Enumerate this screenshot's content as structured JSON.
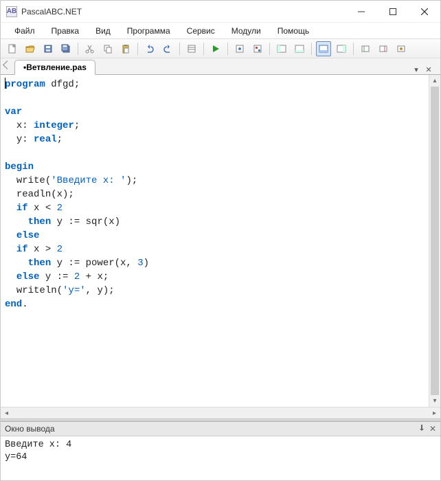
{
  "app": {
    "title": "PascalABC.NET",
    "icon_label": "AB"
  },
  "menu": {
    "file": "Файл",
    "edit": "Правка",
    "view": "Вид",
    "program": "Программа",
    "service": "Сервис",
    "modules": "Модули",
    "help": "Помощь"
  },
  "tab": {
    "label": "•Ветвление.pas"
  },
  "code": {
    "l1_kw": "program",
    "l1_name": " dfgd;",
    "l3_kw": "var",
    "l4_indent": "  ",
    "l4_id": "x: ",
    "l4_type": "integer",
    "l4_semi": ";",
    "l5_indent": "  ",
    "l5_id": "y: ",
    "l5_type": "real",
    "l5_semi": ";",
    "l7_kw": "begin",
    "l8_indent": "  ",
    "l8_fn": "write(",
    "l8_str": "'Введите x: '",
    "l8_end": ");",
    "l9_indent": "  ",
    "l9_txt": "readln(x);",
    "l10_indent": "  ",
    "l10_kw": "if",
    "l10_a": " x < ",
    "l10_num": "2",
    "l11_indent": "    ",
    "l11_kw": "then",
    "l11_a": " y := sqr(x)",
    "l12_indent": "  ",
    "l12_kw": "else",
    "l13_indent": "  ",
    "l13_kw": "if",
    "l13_a": " x > ",
    "l13_num": "2",
    "l14_indent": "    ",
    "l14_kw": "then",
    "l14_a": " y := power(x, ",
    "l14_num": "3",
    "l14_end": ")",
    "l15_indent": "  ",
    "l15_kw": "else",
    "l15_a": " y := ",
    "l15_num": "2",
    "l15_b": " + x;",
    "l16_indent": "  ",
    "l16_a": "writeln(",
    "l16_str": "'y='",
    "l16_b": ", y);",
    "l17_kw": "end",
    "l17_dot": "."
  },
  "output_panel": {
    "title": "Окно вывода",
    "line1": "Введите x: 4",
    "line2": "y=64"
  }
}
